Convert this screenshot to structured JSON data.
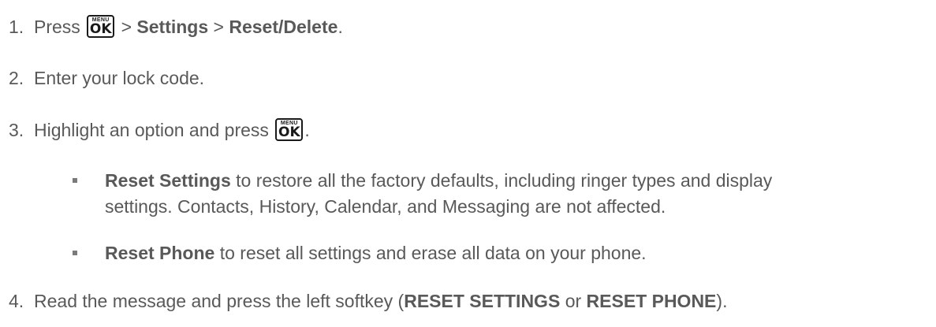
{
  "steps": [
    {
      "num": "1.",
      "press": "Press",
      "gt1": ">",
      "settings": "Settings",
      "gt2": ">",
      "reset_delete": "Reset/Delete",
      "end": "."
    },
    {
      "num": "2.",
      "text": "Enter your lock code."
    },
    {
      "num": "3.",
      "text": "Highlight an option and press",
      "end": "."
    },
    {
      "num": "4.",
      "text_a": "Read the message and press the left softkey (",
      "bold_a": "RESET SETTINGS",
      "or": "or",
      "bold_b": "RESET PHONE",
      "end": ")."
    }
  ],
  "bullets": [
    {
      "bold": "Reset Settings",
      "line1": "to restore all the factory defaults, including ringer types and display",
      "line2": "settings. Contacts, History, Calendar, and Messaging are not affected."
    },
    {
      "bold": "Reset Phone",
      "text": "to reset all settings and erase all data on your phone."
    }
  ],
  "menu_key": {
    "top": "MENU",
    "label": "OK",
    "icon": "menu-ok-key-icon"
  }
}
